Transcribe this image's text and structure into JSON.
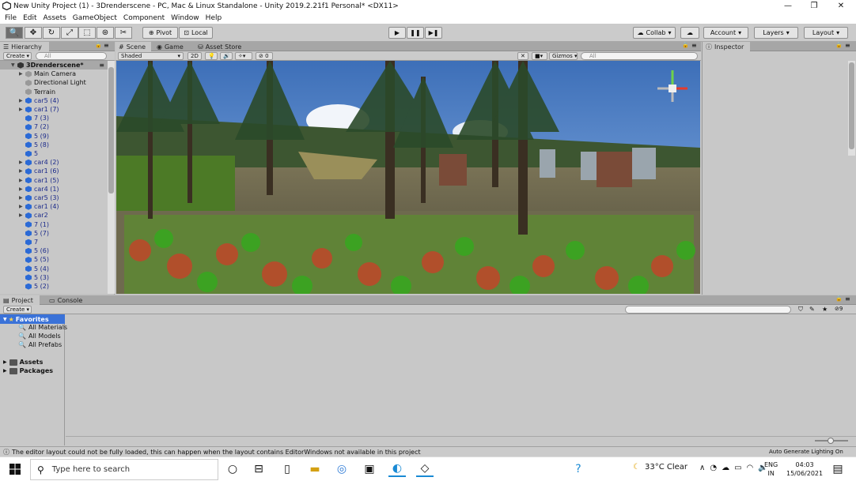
{
  "window": {
    "title": "New Unity Project (1) - 3Drenderscene - PC, Mac & Linux Standalone - Unity 2019.2.21f1 Personal* <DX11>",
    "controls": [
      "—",
      "❐",
      "✕"
    ]
  },
  "menu": [
    "File",
    "Edit",
    "Assets",
    "GameObject",
    "Component",
    "Window",
    "Help"
  ],
  "toolbar": {
    "pivot": "Pivot",
    "local": "Local",
    "collab": "Collab",
    "account": "Account",
    "layers": "Layers",
    "layout": "Layout"
  },
  "hierarchy": {
    "tab": "Hierarchy",
    "create": "Create",
    "search_placeholder": "All",
    "scene_root": "3Drenderscene*",
    "items": [
      {
        "label": "Main Camera",
        "icon": "grey-cube",
        "color": "black",
        "expandable": true
      },
      {
        "label": "Directional Light",
        "icon": "grey-cube",
        "color": "black",
        "expandable": false
      },
      {
        "label": "Terrain",
        "icon": "grey-cube",
        "color": "black",
        "expandable": false
      },
      {
        "label": "car5 (4)",
        "icon": "blue-cube",
        "color": "blue",
        "expandable": true
      },
      {
        "label": "car1 (7)",
        "icon": "blue-cube",
        "color": "blue",
        "expandable": true
      },
      {
        "label": "7 (3)",
        "icon": "blue-cube",
        "color": "blue",
        "expandable": false
      },
      {
        "label": "7 (2)",
        "icon": "blue-cube",
        "color": "blue",
        "expandable": false
      },
      {
        "label": "5 (9)",
        "icon": "blue-cube",
        "color": "blue",
        "expandable": false
      },
      {
        "label": "5 (8)",
        "icon": "blue-cube",
        "color": "blue",
        "expandable": false
      },
      {
        "label": "5",
        "icon": "blue-cube",
        "color": "blue",
        "expandable": false
      },
      {
        "label": "car4 (2)",
        "icon": "blue-cube",
        "color": "blue",
        "expandable": true
      },
      {
        "label": "car1 (6)",
        "icon": "blue-cube",
        "color": "blue",
        "expandable": true
      },
      {
        "label": "car1 (5)",
        "icon": "blue-cube",
        "color": "blue",
        "expandable": true
      },
      {
        "label": "car4 (1)",
        "icon": "blue-cube",
        "color": "blue",
        "expandable": true
      },
      {
        "label": "car5 (3)",
        "icon": "blue-cube",
        "color": "blue",
        "expandable": true
      },
      {
        "label": "car1 (4)",
        "icon": "blue-cube",
        "color": "blue",
        "expandable": true
      },
      {
        "label": "car2",
        "icon": "blue-cube",
        "color": "blue",
        "expandable": true
      },
      {
        "label": "7 (1)",
        "icon": "blue-cube",
        "color": "blue",
        "expandable": false
      },
      {
        "label": "5 (7)",
        "icon": "blue-cube",
        "color": "blue",
        "expandable": false
      },
      {
        "label": "7",
        "icon": "blue-cube",
        "color": "blue",
        "expandable": false
      },
      {
        "label": "5 (6)",
        "icon": "blue-cube",
        "color": "blue",
        "expandable": false
      },
      {
        "label": "5 (5)",
        "icon": "blue-cube",
        "color": "blue",
        "expandable": false
      },
      {
        "label": "5 (4)",
        "icon": "blue-cube",
        "color": "blue",
        "expandable": false
      },
      {
        "label": "5 (3)",
        "icon": "blue-cube",
        "color": "blue",
        "expandable": false
      },
      {
        "label": "5 (2)",
        "icon": "blue-cube",
        "color": "blue",
        "expandable": false
      }
    ]
  },
  "scene_view": {
    "tabs": [
      "Scene",
      "Game",
      "Asset Store"
    ],
    "shading": "Shaded",
    "mode_2d": "2D",
    "hidden_count": "0",
    "gizmos": "Gizmos",
    "search_placeholder": "All"
  },
  "inspector": {
    "tab": "Inspector"
  },
  "project": {
    "tabs": [
      "Project",
      "Console"
    ],
    "create": "Create",
    "favorites_label": "Favorites",
    "favorites": [
      "All Materials",
      "All Models",
      "All Prefabs"
    ],
    "roots": [
      "Assets",
      "Packages"
    ],
    "hidden_count": "9"
  },
  "status": {
    "message": "The editor layout could not be fully loaded, this can happen when the layout contains EditorWindows not available in this project",
    "right": "Auto Generate Lighting On"
  },
  "taskbar": {
    "search_placeholder": "Type here to search",
    "weather": "33°C  Clear",
    "lang_top": "ENG",
    "lang_bottom": "IN",
    "time": "04:03",
    "date": "15/06/2021"
  },
  "colors": {
    "editor_bg": "#c2c2c2",
    "hierarchy_blue": "#1b2a8a",
    "selection_blue": "#3a72d8"
  }
}
